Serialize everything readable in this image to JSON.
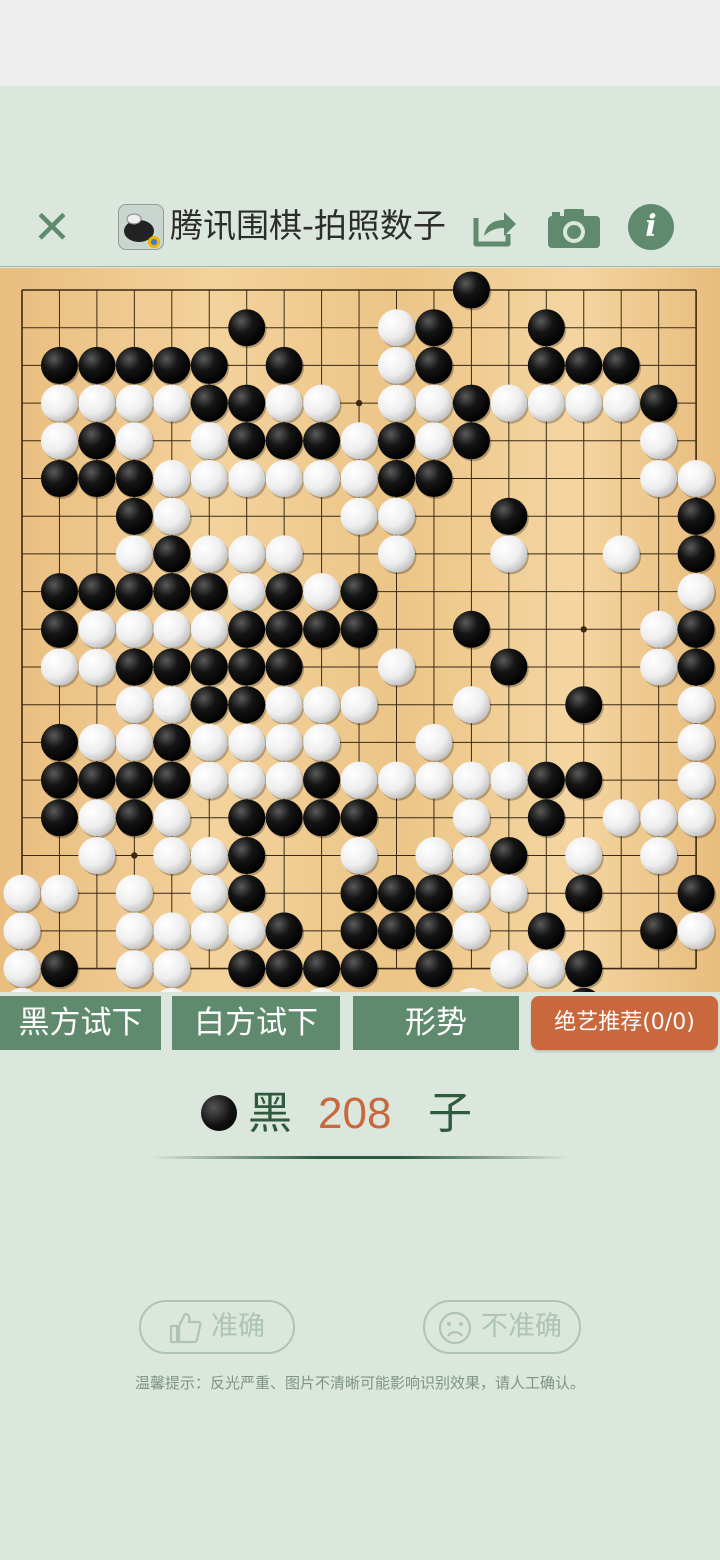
{
  "header": {
    "title": "腾讯围棋-拍照数子",
    "icons": [
      "close-icon",
      "app-logo-icon",
      "share-icon",
      "camera-icon",
      "info-icon"
    ],
    "info_glyph": "i"
  },
  "board": {
    "size": 19,
    "wood_color": "#efc78d",
    "rows": [
      "............B......",
      "......B...WB..B....",
      ".BBBBB.B..WB..BBB..",
      ".WWWWBBWW.WWBWWWWB.",
      ".WBW.WBBBWBWB....W.",
      ".BBBWWWWWWBB.....WW",
      "...BW....WW..B....B",
      "...WBWWW..W..W..W.B",
      ".BBBBBWBWB........W",
      ".BWWWWBBBB..B....WB",
      ".WWBBBBB..W..B...WB",
      "...WWBBWWW..W..B..W",
      ".BWWBWWWW..W......W",
      ".BBBBWWWBWWWWWBB..W",
      ".BWBW.BBBB..W.B.WWW",
      "..W.WWB..W.WWB.W.W.",
      "WW.W.WB..BBBWW.B..B",
      "W..WWWWB.BBBW.B..BW",
      "WB.WW.BBBB.B.WWB...",
      "W...W...W...W..B..."
    ]
  },
  "actions": [
    {
      "label": "黑方试下"
    },
    {
      "label": "白方试下"
    },
    {
      "label": "形势"
    }
  ],
  "recommend": {
    "label": "绝艺推荐(0/0)"
  },
  "count": {
    "color_label": "黑",
    "number": "208",
    "unit": "子"
  },
  "feedback": {
    "accurate": {
      "label": "准确",
      "icon": "thumbs-up-icon"
    },
    "inaccurate": {
      "label": "不准确",
      "icon": "sad-face-icon"
    }
  },
  "tip": "温馨提示：反光严重、图片不清晰可能影响识别效果，请人工确认。",
  "colors": {
    "accent_green": "#5f8a6e",
    "accent_orange": "#c9673d",
    "background": "#dbe6dc"
  }
}
